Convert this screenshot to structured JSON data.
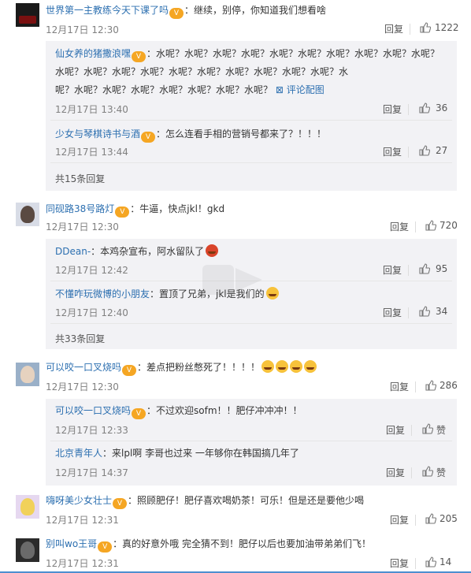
{
  "comments": [
    {
      "username": "世界第一主教练今天下课了吗",
      "text": "：继续，别停，你知道我们想看啥",
      "date": "12月17日 12:30",
      "reply_label": "回复",
      "likes": "1222",
      "replies": [
        {
          "username": "仙女养的猪撒浪嘿",
          "text_lines": [
            "：水呢？水呢？水呢？水呢？水呢？水呢？水呢？水呢？水呢？水呢？",
            "水呢？水呢？水呢？水呢？水呢？水呢？水呢？水呢？水呢？水呢？水",
            "呢？水呢？水呢？水呢？水呢？水呢？水呢？水呢？"
          ],
          "gallery_link": "评论配图",
          "date": "12月17日 13:40",
          "reply_label": "回复",
          "likes": "36"
        },
        {
          "username": "少女与琴棋诗书与酒",
          "text": "：怎么连看手相的营销号都来了？！！！",
          "date": "12月17日 13:44",
          "reply_label": "回复",
          "likes": "27"
        }
      ],
      "more_replies": "共15条回复"
    },
    {
      "username": "同砚路38号路灯",
      "text": "：牛逼，快点jkl！gkd",
      "date": "12月17日 12:30",
      "reply_label": "回复",
      "likes": "720",
      "replies": [
        {
          "username": "DDean-",
          "text": "：本鸡杂宣布，阿水留队了",
          "date": "12月17日 12:42",
          "reply_label": "回复",
          "likes": "95"
        },
        {
          "username": "不懂咋玩微博的小朋友",
          "text": "：置顶了兄弟，jkl是我们的",
          "date": "12月17日 12:40",
          "reply_label": "回复",
          "likes": "34"
        }
      ],
      "more_replies": "共33条回复"
    },
    {
      "username": "可以咬一口叉烧吗",
      "text": "：差点把粉丝憋死了！！！！",
      "date": "12月17日 12:30",
      "reply_label": "回复",
      "likes": "286",
      "replies": [
        {
          "username": "可以咬一口叉烧吗",
          "text": "：不过欢迎sofm！！肥仔冲冲冲！！",
          "date": "12月17日 12:33",
          "reply_label": "回复",
          "likes": "赞"
        },
        {
          "username": "北京青年人",
          "text": "：来lpl啊  李哥也过来  一年够你在韩国搞几年了",
          "date": "12月17日 14:37",
          "reply_label": "回复",
          "likes": "赞"
        }
      ]
    },
    {
      "username": "嗨呀美少女壮士",
      "text": "：照顾肥仔！肥仔喜欢喝奶茶！可乐！但是还是要他少喝",
      "date": "12月17日 12:31",
      "reply_label": "回复",
      "likes": "205"
    },
    {
      "username": "别叫wo王哥",
      "text": "：真的好意外哦 完全猜不到！肥仔以后也要加油带弟弟们飞！",
      "date": "12月17日 12:31",
      "reply_label": "回复",
      "likes": "14"
    }
  ]
}
